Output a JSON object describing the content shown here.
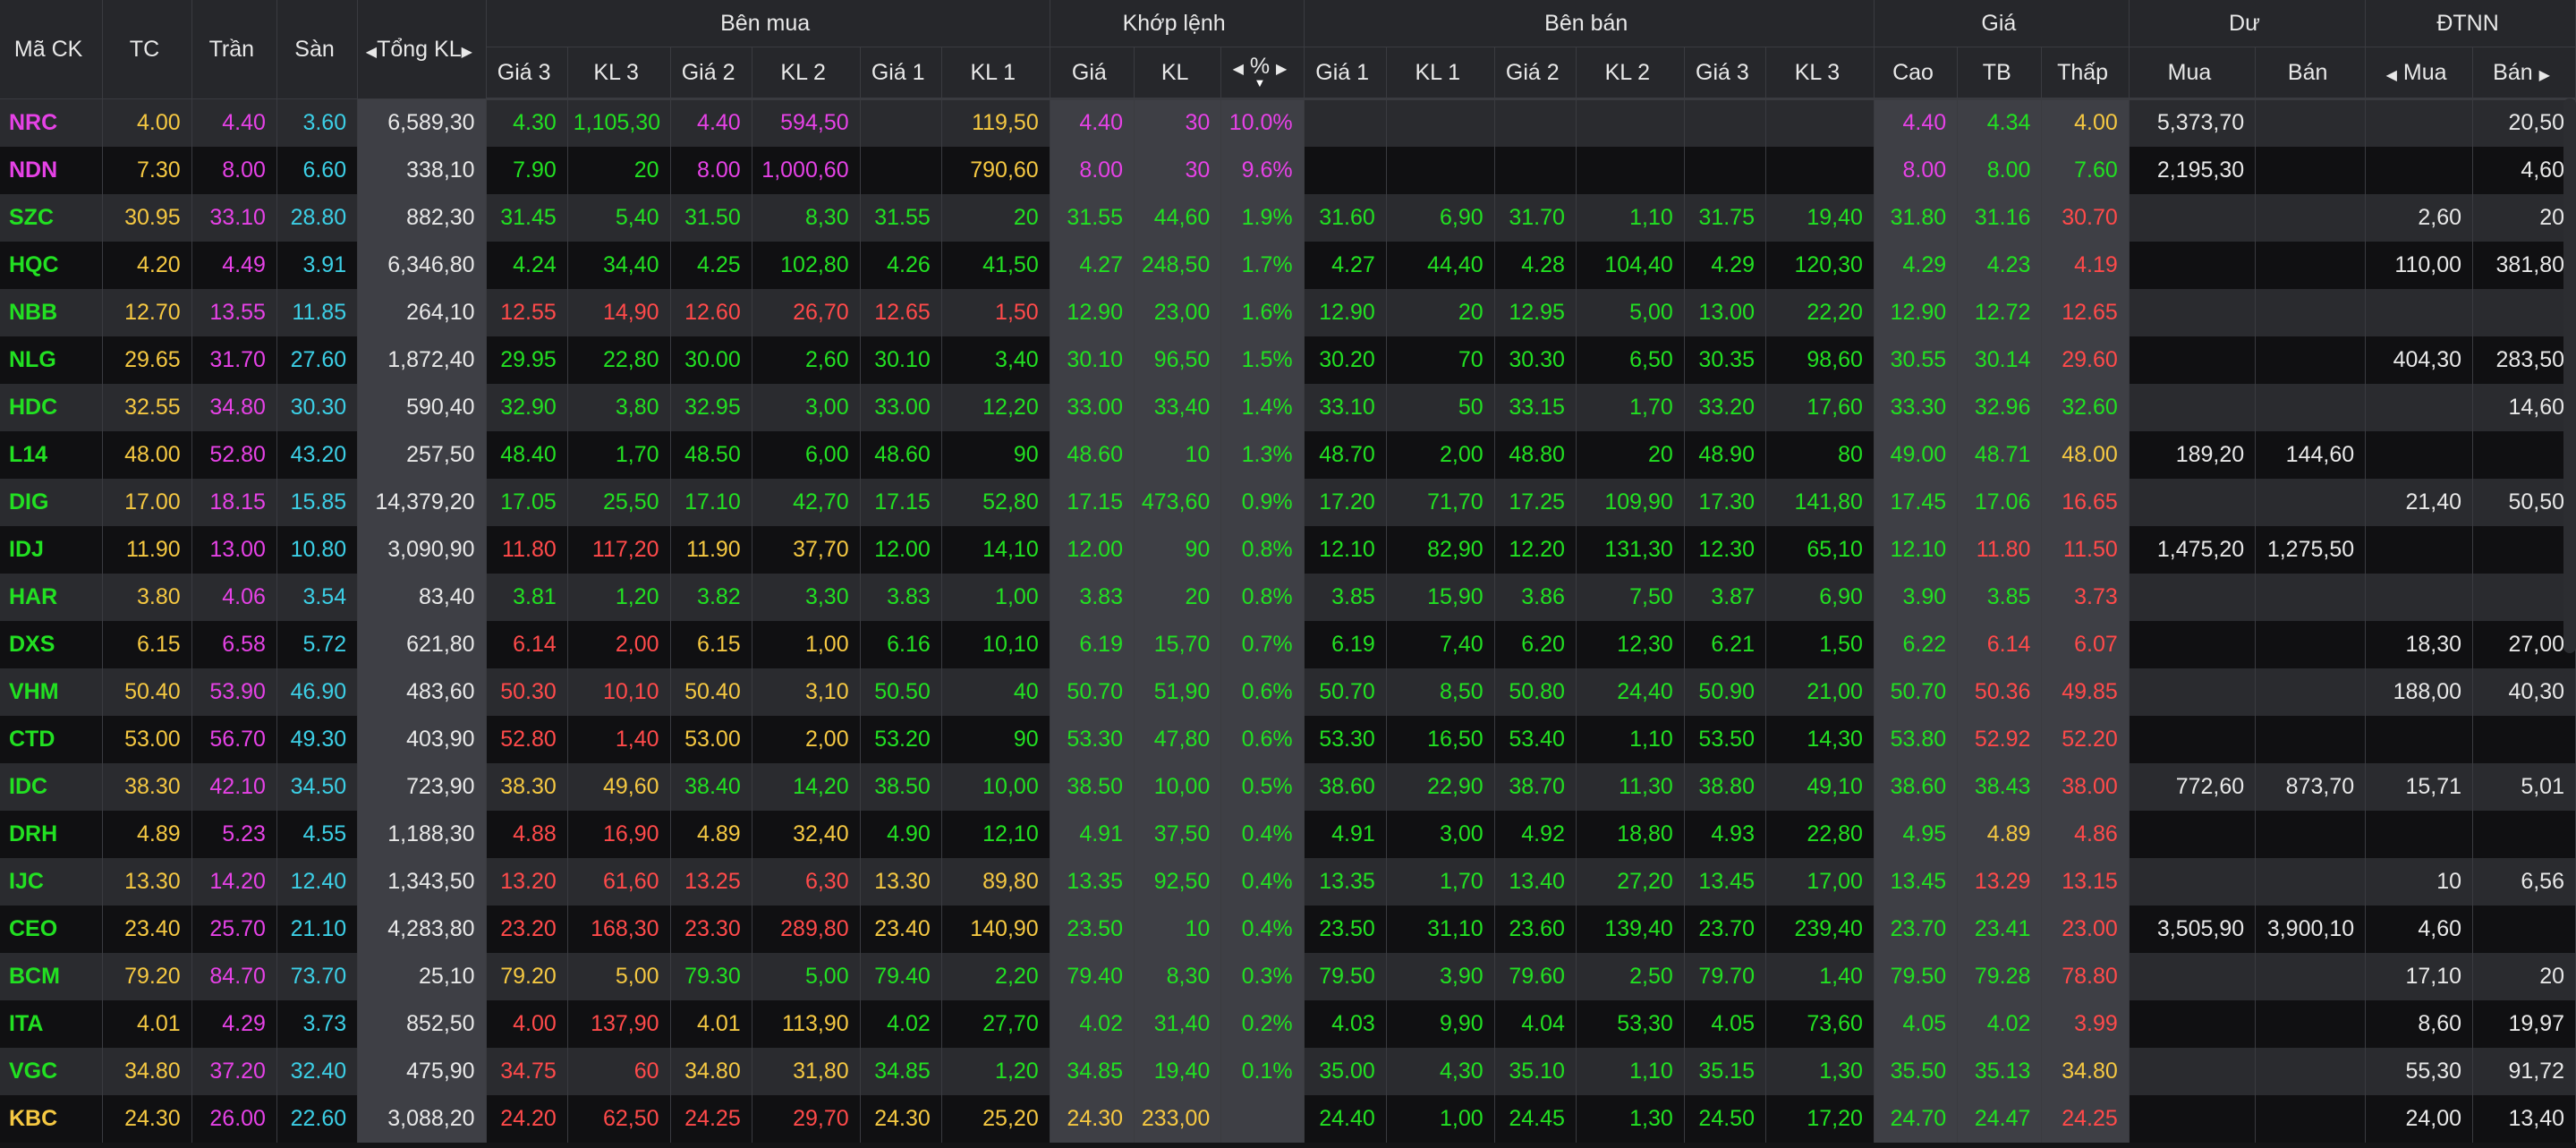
{
  "headers": {
    "symbol": "Mã CK",
    "ref": "TC",
    "ceil": "Trần",
    "floor": "Sàn",
    "total_vol": "Tổng KL",
    "bid_group": "Bên mua",
    "match_group": "Khớp lệnh",
    "ask_group": "Bên bán",
    "price_group": "Giá",
    "remain_group": "Dư",
    "foreign_group": "ĐTNN",
    "bid_cols": [
      "Giá 3",
      "KL 3",
      "Giá 2",
      "KL 2",
      "Giá 1",
      "KL 1"
    ],
    "match_cols": [
      "Giá",
      "KL",
      "%"
    ],
    "ask_cols": [
      "Giá 1",
      "KL 1",
      "Giá 2",
      "KL 2",
      "Giá 3",
      "KL 3"
    ],
    "price_cols": [
      "Cao",
      "TB",
      "Thấp"
    ],
    "remain_cols": [
      "Mua",
      "Bán"
    ],
    "foreign_cols": [
      "Mua",
      "Bán"
    ]
  },
  "colors": {
    "ref": "#f5c842",
    "ceil": "#e642e6",
    "floor": "#3ccfe6",
    "up": "#22e022",
    "down": "#ff4a4a",
    "text": "#e8e8e8",
    "bg_odd": "#2a2b2f",
    "bg_even": "#101012"
  },
  "rows": [
    {
      "sym": "NRC",
      "st": "c",
      "tc": "4.00",
      "tran": "4.40",
      "san": "3.60",
      "tkl": "6,589,30",
      "b3": "4.30",
      "b3s": "u",
      "bk3": "1,105,30",
      "b2": "4.40",
      "b2s": "c",
      "bk2": "594,50",
      "b1": "",
      "b1s": "",
      "bk1": "119,50",
      "bk1s": "r",
      "mp": "4.40",
      "ms": "c",
      "mkl": "30",
      "pct": "10.0%",
      "s1": "",
      "s1s": "",
      "sk1": "",
      "s2": "",
      "s2s": "",
      "sk2": "",
      "s3": "",
      "s3s": "",
      "sk3": "",
      "cao": "4.40",
      "caos": "c",
      "tb": "4.34",
      "tbs": "u",
      "thap": "4.00",
      "thaps": "r",
      "dm": "5,373,70",
      "db": "",
      "nm": "",
      "nb": "20,50"
    },
    {
      "sym": "NDN",
      "st": "c",
      "tc": "7.30",
      "tran": "8.00",
      "san": "6.60",
      "tkl": "338,10",
      "b3": "7.90",
      "b3s": "u",
      "bk3": "20",
      "b2": "8.00",
      "b2s": "c",
      "bk2": "1,000,60",
      "b1": "",
      "b1s": "",
      "bk1": "790,60",
      "bk1s": "r",
      "mp": "8.00",
      "ms": "c",
      "mkl": "30",
      "pct": "9.6%",
      "s1": "",
      "s1s": "",
      "sk1": "",
      "s2": "",
      "s2s": "",
      "sk2": "",
      "s3": "",
      "s3s": "",
      "sk3": "",
      "cao": "8.00",
      "caos": "c",
      "tb": "8.00",
      "tbs": "u",
      "thap": "7.60",
      "thaps": "u",
      "dm": "2,195,30",
      "db": "",
      "nm": "",
      "nb": "4,60"
    },
    {
      "sym": "SZC",
      "st": "u",
      "tc": "30.95",
      "tran": "33.10",
      "san": "28.80",
      "tkl": "882,30",
      "b3": "31.45",
      "b3s": "u",
      "bk3": "5,40",
      "b2": "31.50",
      "b2s": "u",
      "bk2": "8,30",
      "b1": "31.55",
      "b1s": "u",
      "bk1": "20",
      "bk1s": "u",
      "mp": "31.55",
      "ms": "u",
      "mkl": "44,60",
      "pct": "1.9%",
      "s1": "31.60",
      "s1s": "u",
      "sk1": "6,90",
      "s2": "31.70",
      "s2s": "u",
      "sk2": "1,10",
      "s3": "31.75",
      "s3s": "u",
      "sk3": "19,40",
      "cao": "31.80",
      "caos": "u",
      "tb": "31.16",
      "tbs": "u",
      "thap": "30.70",
      "thaps": "d",
      "dm": "",
      "db": "",
      "nm": "2,60",
      "nb": "20"
    },
    {
      "sym": "HQC",
      "st": "u",
      "tc": "4.20",
      "tran": "4.49",
      "san": "3.91",
      "tkl": "6,346,80",
      "b3": "4.24",
      "b3s": "u",
      "bk3": "34,40",
      "b2": "4.25",
      "b2s": "u",
      "bk2": "102,80",
      "b1": "4.26",
      "b1s": "u",
      "bk1": "41,50",
      "bk1s": "u",
      "mp": "4.27",
      "ms": "u",
      "mkl": "248,50",
      "pct": "1.7%",
      "s1": "4.27",
      "s1s": "u",
      "sk1": "44,40",
      "s2": "4.28",
      "s2s": "u",
      "sk2": "104,40",
      "s3": "4.29",
      "s3s": "u",
      "sk3": "120,30",
      "cao": "4.29",
      "caos": "u",
      "tb": "4.23",
      "tbs": "u",
      "thap": "4.19",
      "thaps": "d",
      "dm": "",
      "db": "",
      "nm": "110,00",
      "nb": "381,80"
    },
    {
      "sym": "NBB",
      "st": "u",
      "tc": "12.70",
      "tran": "13.55",
      "san": "11.85",
      "tkl": "264,10",
      "b3": "12.55",
      "b3s": "d",
      "bk3": "14,90",
      "b2": "12.60",
      "b2s": "d",
      "bk2": "26,70",
      "b1": "12.65",
      "b1s": "d",
      "bk1": "1,50",
      "bk1s": "d",
      "mp": "12.90",
      "ms": "u",
      "mkl": "23,00",
      "pct": "1.6%",
      "s1": "12.90",
      "s1s": "u",
      "sk1": "20",
      "s2": "12.95",
      "s2s": "u",
      "sk2": "5,00",
      "s3": "13.00",
      "s3s": "u",
      "sk3": "22,20",
      "cao": "12.90",
      "caos": "u",
      "tb": "12.72",
      "tbs": "u",
      "thap": "12.65",
      "thaps": "d",
      "dm": "",
      "db": "",
      "nm": "",
      "nb": ""
    },
    {
      "sym": "NLG",
      "st": "u",
      "tc": "29.65",
      "tran": "31.70",
      "san": "27.60",
      "tkl": "1,872,40",
      "b3": "29.95",
      "b3s": "u",
      "bk3": "22,80",
      "b2": "30.00",
      "b2s": "u",
      "bk2": "2,60",
      "b1": "30.10",
      "b1s": "u",
      "bk1": "3,40",
      "bk1s": "u",
      "mp": "30.10",
      "ms": "u",
      "mkl": "96,50",
      "pct": "1.5%",
      "s1": "30.20",
      "s1s": "u",
      "sk1": "70",
      "s2": "30.30",
      "s2s": "u",
      "sk2": "6,50",
      "s3": "30.35",
      "s3s": "u",
      "sk3": "98,60",
      "cao": "30.55",
      "caos": "u",
      "tb": "30.14",
      "tbs": "u",
      "thap": "29.60",
      "thaps": "d",
      "dm": "",
      "db": "",
      "nm": "404,30",
      "nb": "283,50"
    },
    {
      "sym": "HDC",
      "st": "u",
      "tc": "32.55",
      "tran": "34.80",
      "san": "30.30",
      "tkl": "590,40",
      "b3": "32.90",
      "b3s": "u",
      "bk3": "3,80",
      "b2": "32.95",
      "b2s": "u",
      "bk2": "3,00",
      "b1": "33.00",
      "b1s": "u",
      "bk1": "12,20",
      "bk1s": "u",
      "mp": "33.00",
      "ms": "u",
      "mkl": "33,40",
      "pct": "1.4%",
      "s1": "33.10",
      "s1s": "u",
      "sk1": "50",
      "s2": "33.15",
      "s2s": "u",
      "sk2": "1,70",
      "s3": "33.20",
      "s3s": "u",
      "sk3": "17,60",
      "cao": "33.30",
      "caos": "u",
      "tb": "32.96",
      "tbs": "u",
      "thap": "32.60",
      "thaps": "u",
      "dm": "",
      "db": "",
      "nm": "",
      "nb": "14,60"
    },
    {
      "sym": "L14",
      "st": "u",
      "tc": "48.00",
      "tran": "52.80",
      "san": "43.20",
      "tkl": "257,50",
      "b3": "48.40",
      "b3s": "u",
      "bk3": "1,70",
      "b2": "48.50",
      "b2s": "u",
      "bk2": "6,00",
      "b1": "48.60",
      "b1s": "u",
      "bk1": "90",
      "bk1s": "u",
      "mp": "48.60",
      "ms": "u",
      "mkl": "10",
      "pct": "1.3%",
      "s1": "48.70",
      "s1s": "u",
      "sk1": "2,00",
      "s2": "48.80",
      "s2s": "u",
      "sk2": "20",
      "s3": "48.90",
      "s3s": "u",
      "sk3": "80",
      "cao": "49.00",
      "caos": "u",
      "tb": "48.71",
      "tbs": "u",
      "thap": "48.00",
      "thaps": "r",
      "dm": "189,20",
      "db": "144,60",
      "nm": "",
      "nb": ""
    },
    {
      "sym": "DIG",
      "st": "u",
      "tc": "17.00",
      "tran": "18.15",
      "san": "15.85",
      "tkl": "14,379,20",
      "b3": "17.05",
      "b3s": "u",
      "bk3": "25,50",
      "b2": "17.10",
      "b2s": "u",
      "bk2": "42,70",
      "b1": "17.15",
      "b1s": "u",
      "bk1": "52,80",
      "bk1s": "u",
      "mp": "17.15",
      "ms": "u",
      "mkl": "473,60",
      "pct": "0.9%",
      "s1": "17.20",
      "s1s": "u",
      "sk1": "71,70",
      "s2": "17.25",
      "s2s": "u",
      "sk2": "109,90",
      "s3": "17.30",
      "s3s": "u",
      "sk3": "141,80",
      "cao": "17.45",
      "caos": "u",
      "tb": "17.06",
      "tbs": "u",
      "thap": "16.65",
      "thaps": "d",
      "dm": "",
      "db": "",
      "nm": "21,40",
      "nb": "50,50"
    },
    {
      "sym": "IDJ",
      "st": "u",
      "tc": "11.90",
      "tran": "13.00",
      "san": "10.80",
      "tkl": "3,090,90",
      "b3": "11.80",
      "b3s": "d",
      "bk3": "117,20",
      "b2": "11.90",
      "b2s": "r",
      "bk2": "37,70",
      "b1": "12.00",
      "b1s": "u",
      "bk1": "14,10",
      "bk1s": "u",
      "mp": "12.00",
      "ms": "u",
      "mkl": "90",
      "pct": "0.8%",
      "s1": "12.10",
      "s1s": "u",
      "sk1": "82,90",
      "s2": "12.20",
      "s2s": "u",
      "sk2": "131,30",
      "s3": "12.30",
      "s3s": "u",
      "sk3": "65,10",
      "cao": "12.10",
      "caos": "u",
      "tb": "11.80",
      "tbs": "d",
      "thap": "11.50",
      "thaps": "d",
      "dm": "1,475,20",
      "db": "1,275,50",
      "nm": "",
      "nb": ""
    },
    {
      "sym": "HAR",
      "st": "u",
      "tc": "3.80",
      "tran": "4.06",
      "san": "3.54",
      "tkl": "83,40",
      "b3": "3.81",
      "b3s": "u",
      "bk3": "1,20",
      "b2": "3.82",
      "b2s": "u",
      "bk2": "3,30",
      "b1": "3.83",
      "b1s": "u",
      "bk1": "1,00",
      "bk1s": "u",
      "mp": "3.83",
      "ms": "u",
      "mkl": "20",
      "pct": "0.8%",
      "s1": "3.85",
      "s1s": "u",
      "sk1": "15,90",
      "s2": "3.86",
      "s2s": "u",
      "sk2": "7,50",
      "s3": "3.87",
      "s3s": "u",
      "sk3": "6,90",
      "cao": "3.90",
      "caos": "u",
      "tb": "3.85",
      "tbs": "u",
      "thap": "3.73",
      "thaps": "d",
      "dm": "",
      "db": "",
      "nm": "",
      "nb": ""
    },
    {
      "sym": "DXS",
      "st": "u",
      "tc": "6.15",
      "tran": "6.58",
      "san": "5.72",
      "tkl": "621,80",
      "b3": "6.14",
      "b3s": "d",
      "bk3": "2,00",
      "b2": "6.15",
      "b2s": "r",
      "bk2": "1,00",
      "b1": "6.16",
      "b1s": "u",
      "bk1": "10,10",
      "bk1s": "u",
      "mp": "6.19",
      "ms": "u",
      "mkl": "15,70",
      "pct": "0.7%",
      "s1": "6.19",
      "s1s": "u",
      "sk1": "7,40",
      "s2": "6.20",
      "s2s": "u",
      "sk2": "12,30",
      "s3": "6.21",
      "s3s": "u",
      "sk3": "1,50",
      "cao": "6.22",
      "caos": "u",
      "tb": "6.14",
      "tbs": "d",
      "thap": "6.07",
      "thaps": "d",
      "dm": "",
      "db": "",
      "nm": "18,30",
      "nb": "27,00"
    },
    {
      "sym": "VHM",
      "st": "u",
      "tc": "50.40",
      "tran": "53.90",
      "san": "46.90",
      "tkl": "483,60",
      "b3": "50.30",
      "b3s": "d",
      "bk3": "10,10",
      "b2": "50.40",
      "b2s": "r",
      "bk2": "3,10",
      "b1": "50.50",
      "b1s": "u",
      "bk1": "40",
      "bk1s": "u",
      "mp": "50.70",
      "ms": "u",
      "mkl": "51,90",
      "pct": "0.6%",
      "s1": "50.70",
      "s1s": "u",
      "sk1": "8,50",
      "s2": "50.80",
      "s2s": "u",
      "sk2": "24,40",
      "s3": "50.90",
      "s3s": "u",
      "sk3": "21,00",
      "cao": "50.70",
      "caos": "u",
      "tb": "50.36",
      "tbs": "d",
      "thap": "49.85",
      "thaps": "d",
      "dm": "",
      "db": "",
      "nm": "188,00",
      "nb": "40,30"
    },
    {
      "sym": "CTD",
      "st": "u",
      "tc": "53.00",
      "tran": "56.70",
      "san": "49.30",
      "tkl": "403,90",
      "b3": "52.80",
      "b3s": "d",
      "bk3": "1,40",
      "b2": "53.00",
      "b2s": "r",
      "bk2": "2,00",
      "b1": "53.20",
      "b1s": "u",
      "bk1": "90",
      "bk1s": "u",
      "mp": "53.30",
      "ms": "u",
      "mkl": "47,80",
      "pct": "0.6%",
      "s1": "53.30",
      "s1s": "u",
      "sk1": "16,50",
      "s2": "53.40",
      "s2s": "u",
      "sk2": "1,10",
      "s3": "53.50",
      "s3s": "u",
      "sk3": "14,30",
      "cao": "53.80",
      "caos": "u",
      "tb": "52.92",
      "tbs": "d",
      "thap": "52.20",
      "thaps": "d",
      "dm": "",
      "db": "",
      "nm": "",
      "nb": ""
    },
    {
      "sym": "IDC",
      "st": "u",
      "tc": "38.30",
      "tran": "42.10",
      "san": "34.50",
      "tkl": "723,90",
      "b3": "38.30",
      "b3s": "r",
      "bk3": "49,60",
      "b2": "38.40",
      "b2s": "u",
      "bk2": "14,20",
      "b1": "38.50",
      "b1s": "u",
      "bk1": "10,00",
      "bk1s": "u",
      "mp": "38.50",
      "ms": "u",
      "mkl": "10,00",
      "pct": "0.5%",
      "s1": "38.60",
      "s1s": "u",
      "sk1": "22,90",
      "s2": "38.70",
      "s2s": "u",
      "sk2": "11,30",
      "s3": "38.80",
      "s3s": "u",
      "sk3": "49,10",
      "cao": "38.60",
      "caos": "u",
      "tb": "38.43",
      "tbs": "u",
      "thap": "38.00",
      "thaps": "d",
      "dm": "772,60",
      "db": "873,70",
      "nm": "15,71",
      "nb": "5,01"
    },
    {
      "sym": "DRH",
      "st": "u",
      "tc": "4.89",
      "tran": "5.23",
      "san": "4.55",
      "tkl": "1,188,30",
      "b3": "4.88",
      "b3s": "d",
      "bk3": "16,90",
      "b2": "4.89",
      "b2s": "r",
      "bk2": "32,40",
      "b1": "4.90",
      "b1s": "u",
      "bk1": "12,10",
      "bk1s": "u",
      "mp": "4.91",
      "ms": "u",
      "mkl": "37,50",
      "pct": "0.4%",
      "s1": "4.91",
      "s1s": "u",
      "sk1": "3,00",
      "s2": "4.92",
      "s2s": "u",
      "sk2": "18,80",
      "s3": "4.93",
      "s3s": "u",
      "sk3": "22,80",
      "cao": "4.95",
      "caos": "u",
      "tb": "4.89",
      "tbs": "r",
      "thap": "4.86",
      "thaps": "d",
      "dm": "",
      "db": "",
      "nm": "",
      "nb": ""
    },
    {
      "sym": "IJC",
      "st": "u",
      "tc": "13.30",
      "tran": "14.20",
      "san": "12.40",
      "tkl": "1,343,50",
      "b3": "13.20",
      "b3s": "d",
      "bk3": "61,60",
      "b2": "13.25",
      "b2s": "d",
      "bk2": "6,30",
      "b1": "13.30",
      "b1s": "r",
      "bk1": "89,80",
      "bk1s": "r",
      "mp": "13.35",
      "ms": "u",
      "mkl": "92,50",
      "pct": "0.4%",
      "s1": "13.35",
      "s1s": "u",
      "sk1": "1,70",
      "s2": "13.40",
      "s2s": "u",
      "sk2": "27,20",
      "s3": "13.45",
      "s3s": "u",
      "sk3": "17,00",
      "cao": "13.45",
      "caos": "u",
      "tb": "13.29",
      "tbs": "d",
      "thap": "13.15",
      "thaps": "d",
      "dm": "",
      "db": "",
      "nm": "10",
      "nb": "6,56"
    },
    {
      "sym": "CEO",
      "st": "u",
      "tc": "23.40",
      "tran": "25.70",
      "san": "21.10",
      "tkl": "4,283,80",
      "b3": "23.20",
      "b3s": "d",
      "bk3": "168,30",
      "b2": "23.30",
      "b2s": "d",
      "bk2": "289,80",
      "b1": "23.40",
      "b1s": "r",
      "bk1": "140,90",
      "bk1s": "r",
      "mp": "23.50",
      "ms": "u",
      "mkl": "10",
      "pct": "0.4%",
      "s1": "23.50",
      "s1s": "u",
      "sk1": "31,10",
      "s2": "23.60",
      "s2s": "u",
      "sk2": "139,40",
      "s3": "23.70",
      "s3s": "u",
      "sk3": "239,40",
      "cao": "23.70",
      "caos": "u",
      "tb": "23.41",
      "tbs": "u",
      "thap": "23.00",
      "thaps": "d",
      "dm": "3,505,90",
      "db": "3,900,10",
      "nm": "4,60",
      "nb": ""
    },
    {
      "sym": "BCM",
      "st": "u",
      "tc": "79.20",
      "tran": "84.70",
      "san": "73.70",
      "tkl": "25,10",
      "b3": "79.20",
      "b3s": "r",
      "bk3": "5,00",
      "b2": "79.30",
      "b2s": "u",
      "bk2": "5,00",
      "b1": "79.40",
      "b1s": "u",
      "bk1": "2,20",
      "bk1s": "u",
      "mp": "79.40",
      "ms": "u",
      "mkl": "8,30",
      "pct": "0.3%",
      "s1": "79.50",
      "s1s": "u",
      "sk1": "3,90",
      "s2": "79.60",
      "s2s": "u",
      "sk2": "2,50",
      "s3": "79.70",
      "s3s": "u",
      "sk3": "1,40",
      "cao": "79.50",
      "caos": "u",
      "tb": "79.28",
      "tbs": "u",
      "thap": "78.80",
      "thaps": "d",
      "dm": "",
      "db": "",
      "nm": "17,10",
      "nb": "20"
    },
    {
      "sym": "ITA",
      "st": "u",
      "tc": "4.01",
      "tran": "4.29",
      "san": "3.73",
      "tkl": "852,50",
      "b3": "4.00",
      "b3s": "d",
      "bk3": "137,90",
      "b2": "4.01",
      "b2s": "r",
      "bk2": "113,90",
      "b1": "4.02",
      "b1s": "u",
      "bk1": "27,70",
      "bk1s": "u",
      "mp": "4.02",
      "ms": "u",
      "mkl": "31,40",
      "pct": "0.2%",
      "s1": "4.03",
      "s1s": "u",
      "sk1": "9,90",
      "s2": "4.04",
      "s2s": "u",
      "sk2": "53,30",
      "s3": "4.05",
      "s3s": "u",
      "sk3": "73,60",
      "cao": "4.05",
      "caos": "u",
      "tb": "4.02",
      "tbs": "u",
      "thap": "3.99",
      "thaps": "d",
      "dm": "",
      "db": "",
      "nm": "8,60",
      "nb": "19,97"
    },
    {
      "sym": "VGC",
      "st": "u",
      "tc": "34.80",
      "tran": "37.20",
      "san": "32.40",
      "tkl": "475,90",
      "b3": "34.75",
      "b3s": "d",
      "bk3": "60",
      "b2": "34.80",
      "b2s": "r",
      "bk2": "31,80",
      "b1": "34.85",
      "b1s": "u",
      "bk1": "1,20",
      "bk1s": "u",
      "mp": "34.85",
      "ms": "u",
      "mkl": "19,40",
      "pct": "0.1%",
      "s1": "35.00",
      "s1s": "u",
      "sk1": "4,30",
      "s2": "35.10",
      "s2s": "u",
      "sk2": "1,10",
      "s3": "35.15",
      "s3s": "u",
      "sk3": "1,30",
      "cao": "35.50",
      "caos": "u",
      "tb": "35.13",
      "tbs": "u",
      "thap": "34.80",
      "thaps": "r",
      "dm": "",
      "db": "",
      "nm": "55,30",
      "nb": "91,72"
    },
    {
      "sym": "KBC",
      "st": "r",
      "tc": "24.30",
      "tran": "26.00",
      "san": "22.60",
      "tkl": "3,088,20",
      "b3": "24.20",
      "b3s": "d",
      "bk3": "62,50",
      "b2": "24.25",
      "b2s": "d",
      "bk2": "29,70",
      "b1": "24.30",
      "b1s": "r",
      "bk1": "25,20",
      "bk1s": "r",
      "mp": "24.30",
      "ms": "r",
      "mkl": "233,00",
      "pct": "",
      "s1": "24.40",
      "s1s": "u",
      "sk1": "1,00",
      "s2": "24.45",
      "s2s": "u",
      "sk2": "1,30",
      "s3": "24.50",
      "s3s": "u",
      "sk3": "17,20",
      "cao": "24.70",
      "caos": "u",
      "tb": "24.47",
      "tbs": "u",
      "thap": "24.25",
      "thaps": "d",
      "dm": "",
      "db": "",
      "nm": "24,00",
      "nb": "13,40"
    }
  ]
}
